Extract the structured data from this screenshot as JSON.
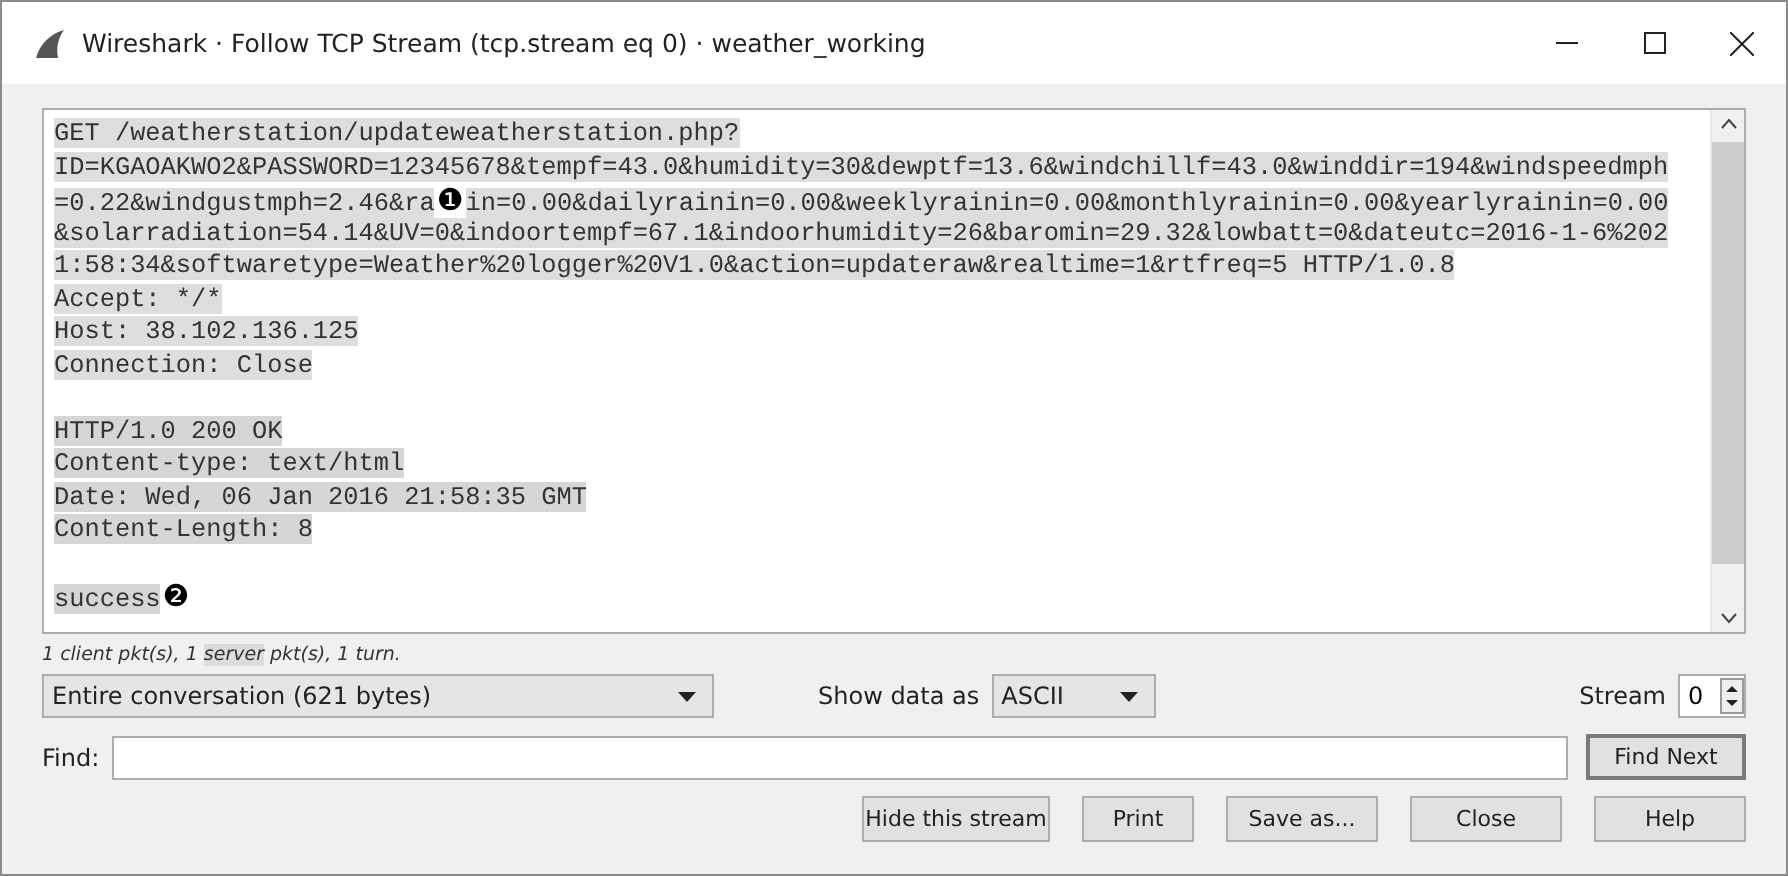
{
  "window": {
    "title": "Wireshark · Follow TCP Stream (tcp.stream eq 0) · weather_working"
  },
  "stream_lines": [
    {
      "kind": "client",
      "segments": [
        {
          "kind": "text",
          "text": "GET /weatherstation/updateweatherstation.php?"
        }
      ]
    },
    {
      "kind": "client",
      "segments": [
        {
          "kind": "text",
          "text": "ID=KGAOAKWO2&PASSWORD=12345678&tempf=43.0&humidity=30&dewptf=13.6&windchillf=43.0&winddir=194&windspeedmph"
        }
      ]
    },
    {
      "kind": "client",
      "segments": [
        {
          "kind": "text",
          "text": "=0.22&windgustmph=2.46&ra"
        },
        {
          "kind": "marker",
          "text": "❶"
        },
        {
          "kind": "text",
          "text": "in=0.00&dailyrainin=0.00&weeklyrainin=0.00&monthlyrainin=0.00&yearlyrainin=0.00"
        }
      ]
    },
    {
      "kind": "client",
      "segments": [
        {
          "kind": "text",
          "text": "&solarradiation=54.14&UV=0&indoortempf=67.1&indoorhumidity=26&baromin=29.32&lowbatt=0&dateutc=2016-1-6%202"
        }
      ]
    },
    {
      "kind": "client",
      "segments": [
        {
          "kind": "text",
          "text": "1:58:34&softwaretype=Weather%20logger%20V1.0&action=updateraw&realtime=1&rtfreq=5 HTTP/1.0.8"
        }
      ]
    },
    {
      "kind": "client",
      "segments": [
        {
          "kind": "text",
          "text": "Accept: */*"
        }
      ]
    },
    {
      "kind": "client",
      "segments": [
        {
          "kind": "text",
          "text": "Host: 38.102.136.125"
        }
      ]
    },
    {
      "kind": "client",
      "segments": [
        {
          "kind": "text",
          "text": "Connection: Close"
        }
      ]
    },
    {
      "kind": "blank"
    },
    {
      "kind": "server",
      "segments": [
        {
          "kind": "text",
          "text": "HTTP/1.0 200 OK"
        }
      ]
    },
    {
      "kind": "server",
      "segments": [
        {
          "kind": "text",
          "text": "Content-type: text/html"
        }
      ]
    },
    {
      "kind": "server",
      "segments": [
        {
          "kind": "text",
          "text": "Date: Wed, 06 Jan 2016 21:58:35 GMT"
        }
      ]
    },
    {
      "kind": "server",
      "segments": [
        {
          "kind": "text",
          "text": "Content-Length: 8"
        }
      ]
    },
    {
      "kind": "blank"
    },
    {
      "kind": "server",
      "segments": [
        {
          "kind": "text",
          "text": "success"
        },
        {
          "kind": "marker",
          "text": "❷"
        }
      ]
    }
  ],
  "status": [
    {
      "text": "1 client pkt(s), 1 ",
      "highlighted": false
    },
    {
      "text": "server",
      "highlighted": true
    },
    {
      "text": " pkt(s), 1 turn.",
      "highlighted": false
    }
  ],
  "conversation_select": {
    "value": "Entire conversation (621 bytes)"
  },
  "show_data_as": {
    "label": "Show data as",
    "value": "ASCII"
  },
  "stream": {
    "label": "Stream",
    "value": "0"
  },
  "find": {
    "label": "Find:",
    "button": "Find Next"
  },
  "buttons": [
    "Hide this stream",
    "Print",
    "Save as...",
    "Close",
    "Help"
  ]
}
